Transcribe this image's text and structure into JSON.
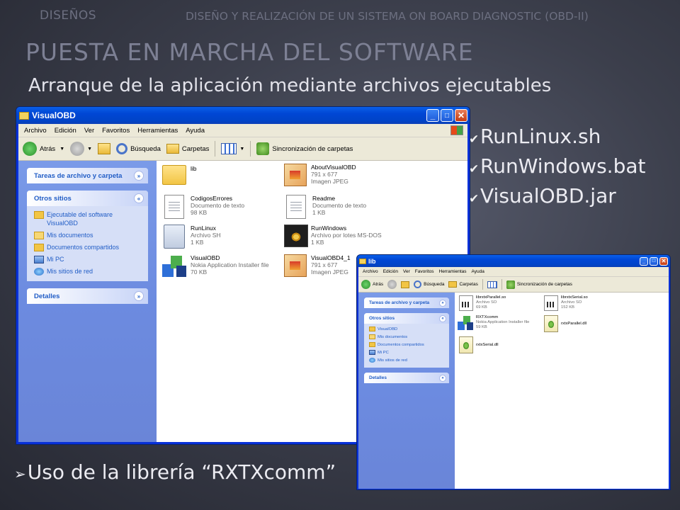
{
  "slide": {
    "header_left": "DISEÑOS",
    "header_right": "DISEÑO Y REALIZACIÓN DE UN SISTEMA ON BOARD DIAGNOSTIC (OBD-II)",
    "title": "PUESTA EN MARCHA DEL SOFTWARE",
    "subtitle": "Arranque de la aplicación mediante archivos ejecutables",
    "checklist": [
      "RunLinux.sh",
      "RunWindows.bat",
      "VisualOBD.jar"
    ],
    "bottom_bullet": "Uso de la librería “RXTXcomm”"
  },
  "window_main": {
    "title": "VisualOBD",
    "menu": [
      "Archivo",
      "Edición",
      "Ver",
      "Favoritos",
      "Herramientas",
      "Ayuda"
    ],
    "toolbar": {
      "back": "Atrás",
      "search": "Búsqueda",
      "folders": "Carpetas",
      "sync": "Sincronización de carpetas"
    },
    "tasks_panel": {
      "title": "Tareas de archivo y carpeta"
    },
    "other_places": {
      "title": "Otros sitios",
      "links": [
        "Ejecutable del software VisualOBD",
        "Mis documentos",
        "Documentos compartidos",
        "Mi PC",
        "Mis sitios de red"
      ]
    },
    "details": {
      "title": "Detalles"
    },
    "files": [
      {
        "name": "lib",
        "meta1": "",
        "meta2": "",
        "icon": "folder"
      },
      {
        "name": "AboutVisualOBD",
        "meta1": "791 x 677",
        "meta2": "Imagen JPEG",
        "icon": "jpg"
      },
      {
        "name": "CodigosErrores",
        "meta1": "Documento de texto",
        "meta2": "98 KB",
        "icon": "text-doc"
      },
      {
        "name": "Readme",
        "meta1": "Documento de texto",
        "meta2": "1 KB",
        "icon": "text-doc"
      },
      {
        "name": "RunLinux",
        "meta1": "Archivo SH",
        "meta2": "1 KB",
        "icon": "shell-script"
      },
      {
        "name": "RunWindows",
        "meta1": "Archivo por lotes MS-DOS",
        "meta2": "1 KB",
        "icon": "batch-file"
      },
      {
        "name": "VisualOBD",
        "meta1": "Nokia Application Installer file",
        "meta2": "70 KB",
        "icon": "jar-installer"
      },
      {
        "name": "VisualOBD4_1",
        "meta1": "791 x 677",
        "meta2": "Imagen JPEG",
        "icon": "jpg"
      }
    ]
  },
  "window_lib": {
    "title": "lib",
    "menu": [
      "Archivo",
      "Edición",
      "Ver",
      "Favoritos",
      "Herramientas",
      "Ayuda"
    ],
    "toolbar": {
      "back": "Atrás",
      "search": "Búsqueda",
      "folders": "Carpetas",
      "sync": "Sincronización de carpetas"
    },
    "tasks_panel": {
      "title": "Tareas de archivo y carpeta"
    },
    "other_places": {
      "title": "Otros sitios",
      "links": [
        "VisualOBD",
        "Mis documentos",
        "Documentos compartidos",
        "Mi PC",
        "Mis sitios de red"
      ]
    },
    "details": {
      "title": "Detalles"
    },
    "files": [
      {
        "name": "librxtxParallel.so",
        "meta1": "Archivo SO",
        "meta2": "69 KB",
        "icon": "so-file"
      },
      {
        "name": "librxtxSerial.so",
        "meta1": "Archivo SO",
        "meta2": "152 KB",
        "icon": "so-file"
      },
      {
        "name": "RXTXcomm",
        "meta1": "Nokia Application Installer file",
        "meta2": "59 KB",
        "icon": "jar-installer"
      },
      {
        "name": "rxtxParallel.dll",
        "meta1": "",
        "meta2": "",
        "icon": "dll-file"
      },
      {
        "name": "rxtxSerial.dll",
        "meta1": "",
        "meta2": "",
        "icon": "dll-file"
      }
    ]
  }
}
